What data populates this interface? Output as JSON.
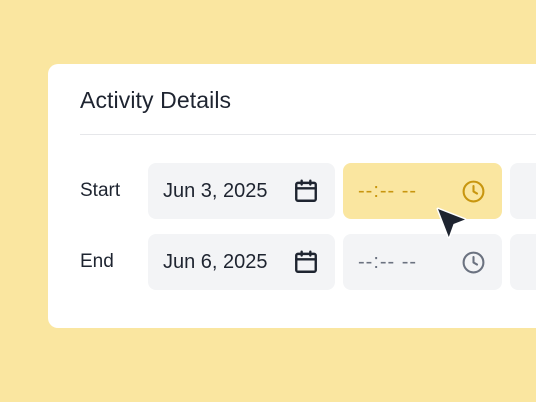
{
  "card": {
    "title": "Activity Details"
  },
  "rows": [
    {
      "label": "Start",
      "date": {
        "value": "Jun 3, 2025",
        "icon": "calendar-icon"
      },
      "time": {
        "value": "--:-- --",
        "icon": "clock-icon",
        "state": "focused"
      }
    },
    {
      "label": "End",
      "date": {
        "value": "Jun 6, 2025",
        "icon": "calendar-icon"
      },
      "time": {
        "value": "--:-- --",
        "icon": "clock-icon",
        "state": "default"
      }
    }
  ],
  "cursor": {
    "icon": "mouse-pointer-icon"
  },
  "colors": {
    "background": "#fae6a0",
    "card": "#ffffff",
    "field_bg": "#f3f4f6",
    "field_focus_bg": "#fae6a0",
    "focus_accent": "#c8960f",
    "text_primary": "#1e2430",
    "text_placeholder": "#6b7280",
    "divider": "#e6e7ea"
  }
}
